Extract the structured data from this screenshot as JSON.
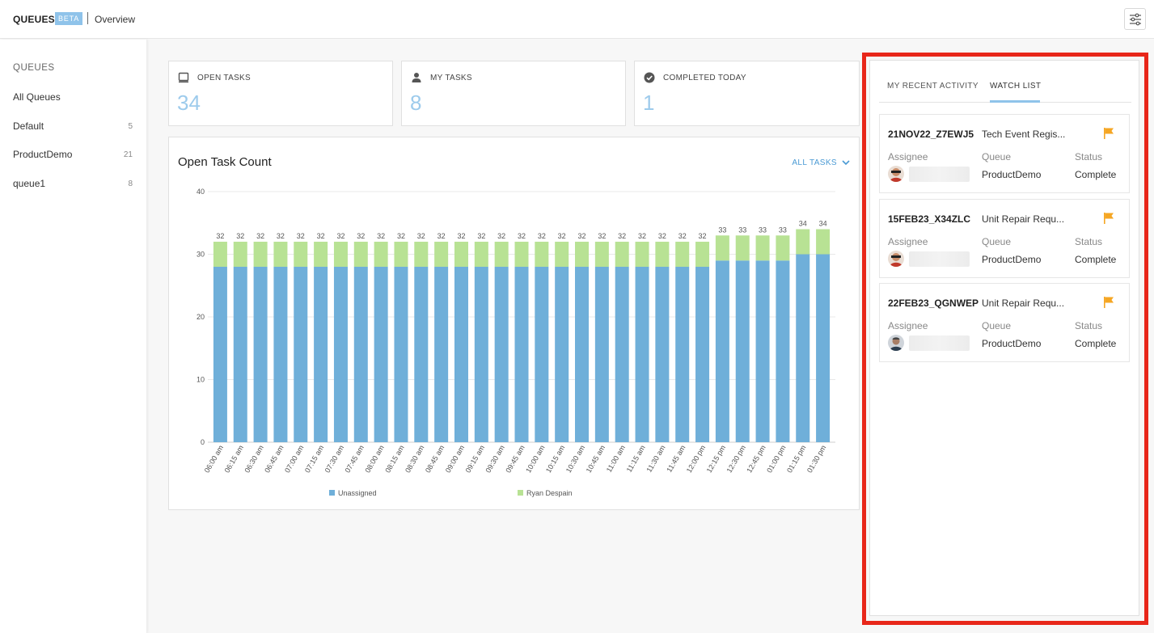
{
  "header": {
    "app_title": "QUEUES",
    "badge": "BETA",
    "breadcrumb": "Overview"
  },
  "sidebar": {
    "heading": "QUEUES",
    "items": [
      {
        "label": "All Queues",
        "count": ""
      },
      {
        "label": "Default",
        "count": "5"
      },
      {
        "label": "ProductDemo",
        "count": "21"
      },
      {
        "label": "queue1",
        "count": "8"
      }
    ]
  },
  "stats": [
    {
      "title": "OPEN TASKS",
      "value": "34",
      "icon": "inbox-icon"
    },
    {
      "title": "MY TASKS",
      "value": "8",
      "icon": "person-icon"
    },
    {
      "title": "COMPLETED TODAY",
      "value": "1",
      "icon": "check-circle-icon"
    }
  ],
  "chart_panel": {
    "title": "Open Task Count",
    "filter_label": "ALL TASKS"
  },
  "chart_data": {
    "type": "bar",
    "stacked": true,
    "categories": [
      "06:00 am",
      "06:15 am",
      "06:30 am",
      "06:45 am",
      "07:00 am",
      "07:15 am",
      "07:30 am",
      "07:45 am",
      "08:00 am",
      "08:15 am",
      "08:30 am",
      "08:45 am",
      "09:00 am",
      "09:15 am",
      "09:30 am",
      "09:45 am",
      "10:00 am",
      "10:15 am",
      "10:30 am",
      "10:45 am",
      "11:00 am",
      "11:15 am",
      "11:30 am",
      "11:45 am",
      "12:00 pm",
      "12:15 pm",
      "12:30 pm",
      "12:45 pm",
      "01:00 pm",
      "01:15 pm",
      "01:30 pm"
    ],
    "series": [
      {
        "name": "Unassigned",
        "color": "#6fafd9",
        "values": [
          28,
          28,
          28,
          28,
          28,
          28,
          28,
          28,
          28,
          28,
          28,
          28,
          28,
          28,
          28,
          28,
          28,
          28,
          28,
          28,
          28,
          28,
          28,
          28,
          28,
          29,
          29,
          29,
          29,
          30,
          30
        ]
      },
      {
        "name": "Ryan Despain",
        "color": "#b8e294",
        "values": [
          4,
          4,
          4,
          4,
          4,
          4,
          4,
          4,
          4,
          4,
          4,
          4,
          4,
          4,
          4,
          4,
          4,
          4,
          4,
          4,
          4,
          4,
          4,
          4,
          4,
          4,
          4,
          4,
          4,
          4,
          4
        ]
      }
    ],
    "totals": [
      32,
      32,
      32,
      32,
      32,
      32,
      32,
      32,
      32,
      32,
      32,
      32,
      32,
      32,
      32,
      32,
      32,
      32,
      32,
      32,
      32,
      32,
      32,
      32,
      32,
      33,
      33,
      33,
      33,
      34,
      34
    ],
    "ylim": [
      0,
      40
    ],
    "yticks": [
      0,
      10,
      20,
      30,
      40
    ],
    "grid": true,
    "legend": "bottom"
  },
  "watch_panel": {
    "tabs": [
      "MY RECENT ACTIVITY",
      "WATCH LIST"
    ],
    "active_tab": "WATCH LIST",
    "labels": {
      "assignee": "Assignee",
      "queue": "Queue",
      "status": "Status"
    },
    "items": [
      {
        "id": "21NOV22_Z7EWJ5",
        "description": "Tech Event Regis...",
        "queue": "ProductDemo",
        "status": "Complete",
        "flag_color": "#f5a623"
      },
      {
        "id": "15FEB23_X34ZLC",
        "description": "Unit Repair Requ...",
        "queue": "ProductDemo",
        "status": "Complete",
        "flag_color": "#f5a623"
      },
      {
        "id": "22FEB23_QGNWEP",
        "description": "Unit Repair Requ...",
        "queue": "ProductDemo",
        "status": "Complete",
        "flag_color": "#f5a623"
      }
    ]
  }
}
